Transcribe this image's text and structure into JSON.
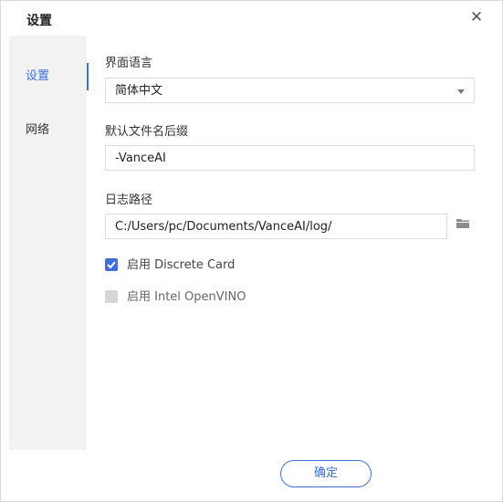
{
  "dialog": {
    "title": "设置",
    "close_icon": "close-icon"
  },
  "sidebar": {
    "items": [
      {
        "label": "设置",
        "active": true
      },
      {
        "label": "网络",
        "active": false
      }
    ]
  },
  "settings": {
    "language": {
      "label": "界面语言",
      "value": "简体中文"
    },
    "filename_suffix": {
      "label": "默认文件名后缀",
      "value": "-VanceAI"
    },
    "log_path": {
      "label": "日志路径",
      "value": "C:/Users/pc/Documents/VanceAI/log/",
      "browse_icon": "folder-icon"
    },
    "discrete_card": {
      "label": "启用 Discrete Card",
      "checked": true
    },
    "openvino": {
      "label": "启用 Intel OpenVINO",
      "checked": false,
      "disabled": true
    }
  },
  "footer": {
    "ok_label": "确定"
  },
  "colors": {
    "accent": "#3d6fd6",
    "sidebar_bg": "#f2f2f2",
    "border": "#dcdcdc"
  }
}
